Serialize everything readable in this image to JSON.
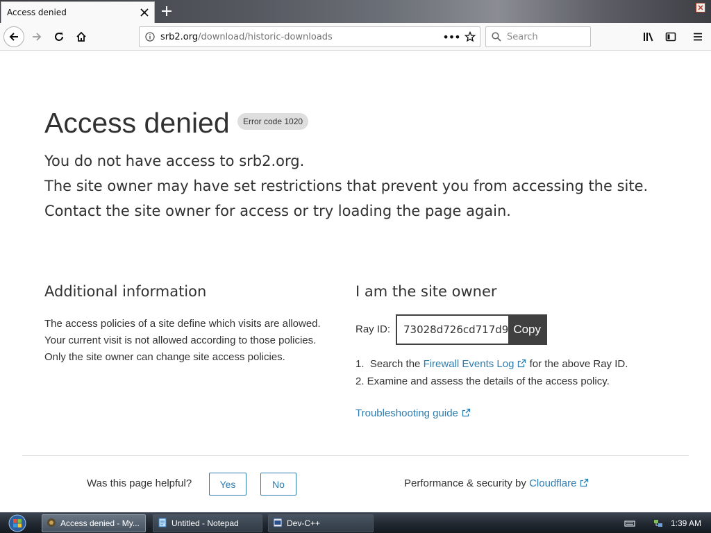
{
  "browser": {
    "tab_title": "Access denied",
    "url_host": "srb2.org",
    "url_path": "/download/historic-downloads",
    "search_placeholder": "Search",
    "url_actions": "•••"
  },
  "page": {
    "title": "Access denied",
    "error_badge": "Error code 1020",
    "lead": [
      "You do not have access to srb2.org.",
      "The site owner may have set restrictions that prevent you from accessing the site.",
      "Contact the site owner for access or try loading the page again."
    ],
    "additional": {
      "heading": "Additional information",
      "lines": [
        "The access policies of a site define which visits are allowed.",
        "Your current visit is not allowed according to those policies.",
        "Only the site owner can change site access policies."
      ]
    },
    "owner": {
      "heading": "I am the site owner",
      "ray_label": "Ray ID:",
      "ray_value": "73028d726cd717d9",
      "copy_label": "Copy",
      "step1_prefix": "1.  Search the ",
      "step1_link": "Firewall Events Log",
      "step1_suffix": " for the above Ray ID.",
      "step2": "2. Examine and assess the details of the access policy.",
      "troubleshooting": "Troubleshooting guide"
    },
    "footer": {
      "helpful_question": "Was this page helpful?",
      "yes": "Yes",
      "no": "No",
      "perf_prefix": "Performance & security by ",
      "perf_link": "Cloudflare"
    },
    "colors": {
      "link": "#2c7cb0",
      "text": "#313131",
      "copy_bg": "#404040"
    }
  },
  "taskbar": {
    "items": [
      {
        "label": "Access denied - My...",
        "icon": "browser-icon"
      },
      {
        "label": "Untitled - Notepad",
        "icon": "notepad-icon"
      },
      {
        "label": "Dev-C++",
        "icon": "devcpp-icon"
      }
    ],
    "clock": "1:39 AM"
  }
}
